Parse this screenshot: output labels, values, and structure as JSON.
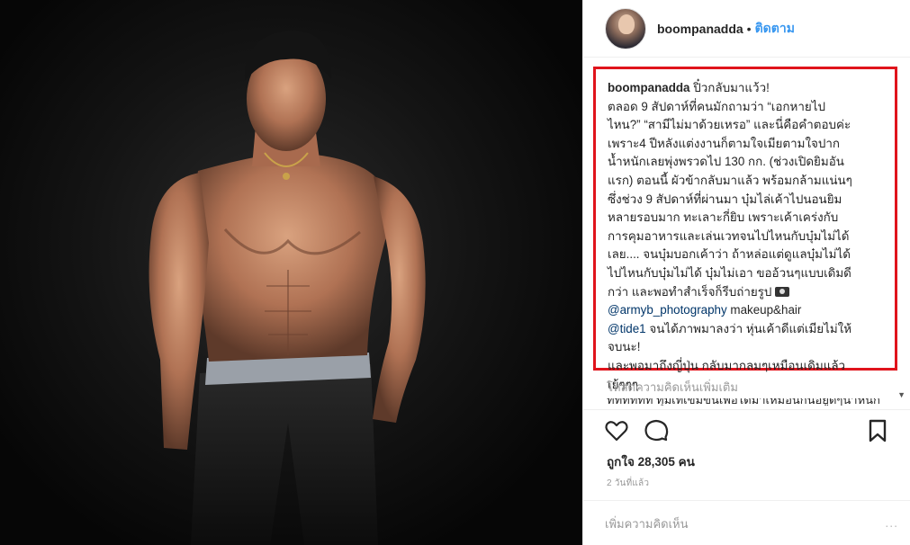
{
  "post": {
    "username": "boompanadda",
    "follow_label": "ติดตาม",
    "separator": "•"
  },
  "caption": {
    "username": "boompanadda",
    "lines": [
      " ปิ๋วกลับมาแว้ว!",
      "ตลอด 9 สัปดาห์ที่คนมักถามว่า “เอกหายไป",
      "ไหน?” “สามีไม่มาด้วยเหรอ” และนี่คือคำตอบค่ะ",
      "เพราะ4 ปีหลังแต่งงานก็ตามใจเมียตามใจปาก",
      "น้ำหนักเลยพุ่งพรวดไป 130 กก. (ช่วงเปิดยิมอัน",
      "แรก) ตอนนี้ ผัวข้ากลับมาแล้ว พร้อมกล้ามแน่นๆ",
      "ซึ่งช่วง 9 สัปดาห์ที่ผ่านมา บุ๋มไล่เค้าไปนอนยิม",
      "หลายรอบมาก ทะเลาะกี่ยิบ เพราะเค้าเคร่งกับ",
      "การคุมอาหารและเล่นเวทจนไปไหนกับบุ๋มไม่ได้",
      "เลย.... จนบุ๋มบอกเค้าว่า ถ้าหล่อแต่ดูแลบุ๋มไม่ได้",
      "ไปไหนกับบุ๋มไม่ได้ บุ๋มไม่เอา ขออ้วนๆแบบเดิมดี",
      "กว่า และพอทำสำเร็จก็รีบถ่ายรูป"
    ],
    "mention_1": "@armyb_photography",
    "after_mention_1": " makeup&hair",
    "mention_2": "@tide1",
    "after_mention_2": " จนได้ภาพมาลงว่า หุ่นเค้าดีแต่เมียไม่ให้",
    "lines_end": [
      "จบนะ!",
      "และพอมาถึงญี่ปุ่น กลับมากลมๆเหมือนเดิมแล้ว",
      "เย้ๆๆๆ"
    ]
  },
  "load_more_label": "โหลดความคิดเห็นเพิ่มเติม",
  "cut_comment_text": "ทททททท ทุ่มเทเข้มข้นเพื่อได้มาเหมือนกันอยู่ดีๆน้ำหนักเพิ่มเช่น",
  "scroll_arrow": "▼",
  "icons": {
    "like": "heart-outline-icon",
    "comment": "speech-bubble-icon",
    "save": "bookmark-icon",
    "camera": "camera-emoji-icon"
  },
  "likes_text": "ถูกใจ 28,305 คน",
  "timestamp": "2 วันที่แล้ว",
  "add_comment_placeholder": "เพิ่มความคิดเห็น",
  "more_dots": "...",
  "colors": {
    "accent_blue": "#3897f0",
    "mention": "#003569",
    "highlight_border": "#e0141c",
    "muted": "#999999"
  }
}
